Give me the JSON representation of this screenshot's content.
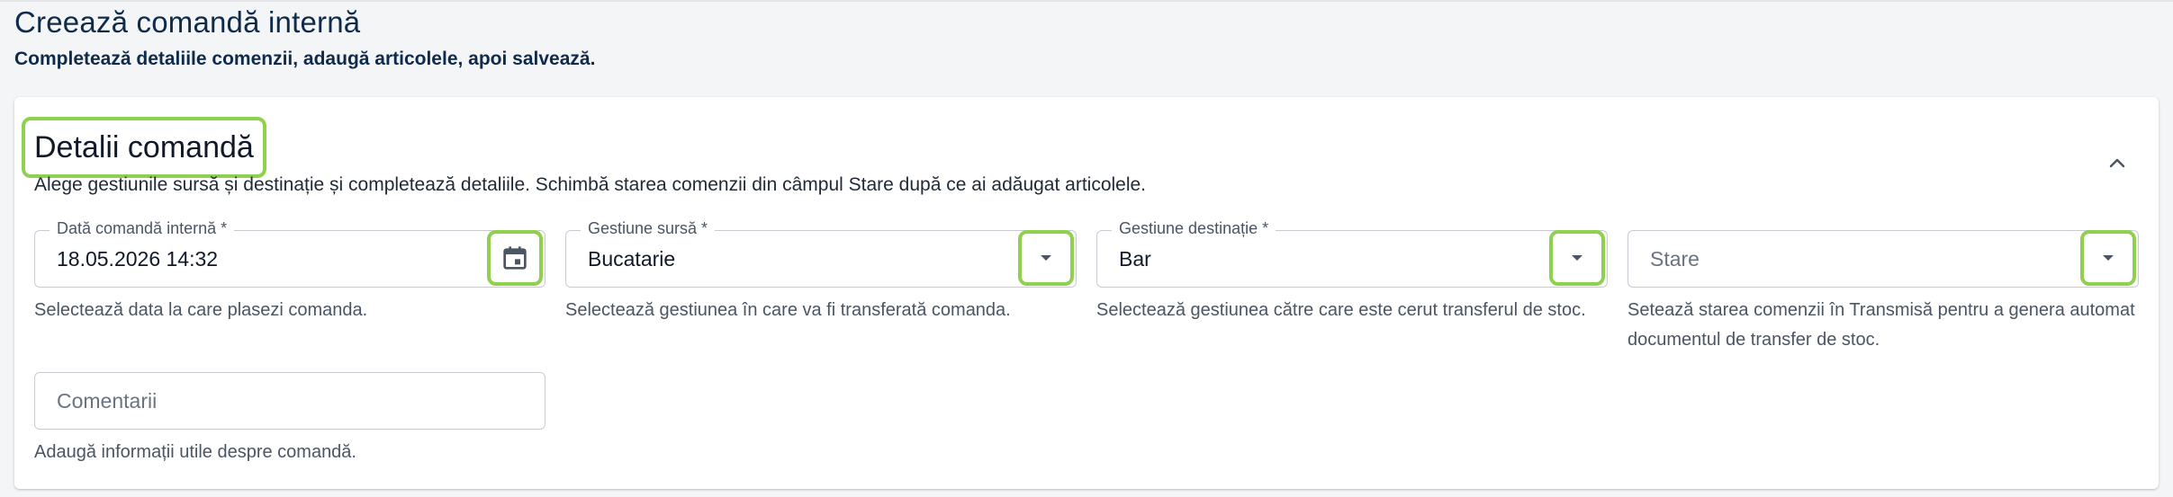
{
  "page": {
    "title": "Creează comandă internă",
    "subtitle": "Completează detaliile comenzii, adaugă articolele, apoi salvează."
  },
  "card": {
    "title": "Detalii comandă",
    "description": "Alege gestiunile sursă și destinație și completează detaliile. Schimbă starea comenzii din câmpul Stare după ce ai adăugat articolele.",
    "collapse_icon": "chevron-up-icon"
  },
  "fields": {
    "date": {
      "label": "Dată comandă internă *",
      "value": "18.05.2026 14:32",
      "helper": "Selectează data la care plasezi comanda.",
      "icon": "calendar-icon"
    },
    "source": {
      "label": "Gestiune sursă *",
      "value": "Bucatarie",
      "helper": "Selectează gestiunea în care va fi transferată comanda.",
      "icon": "dropdown-arrow-icon"
    },
    "destination": {
      "label": "Gestiune destinație *",
      "value": "Bar",
      "helper": "Selectează gestiunea către care este cerut transferul de stoc.",
      "icon": "dropdown-arrow-icon"
    },
    "status": {
      "placeholder": "Stare",
      "helper": "Setează starea comenzii în Transmisă pentru a genera automat documentul de transfer de stoc.",
      "icon": "dropdown-arrow-icon"
    },
    "comments": {
      "placeholder": "Comentarii",
      "helper": "Adaugă informații utile despre comandă."
    }
  },
  "colors": {
    "highlight": "#8fd14f",
    "title": "#0f2b4c",
    "border": "#c7cbd1"
  }
}
